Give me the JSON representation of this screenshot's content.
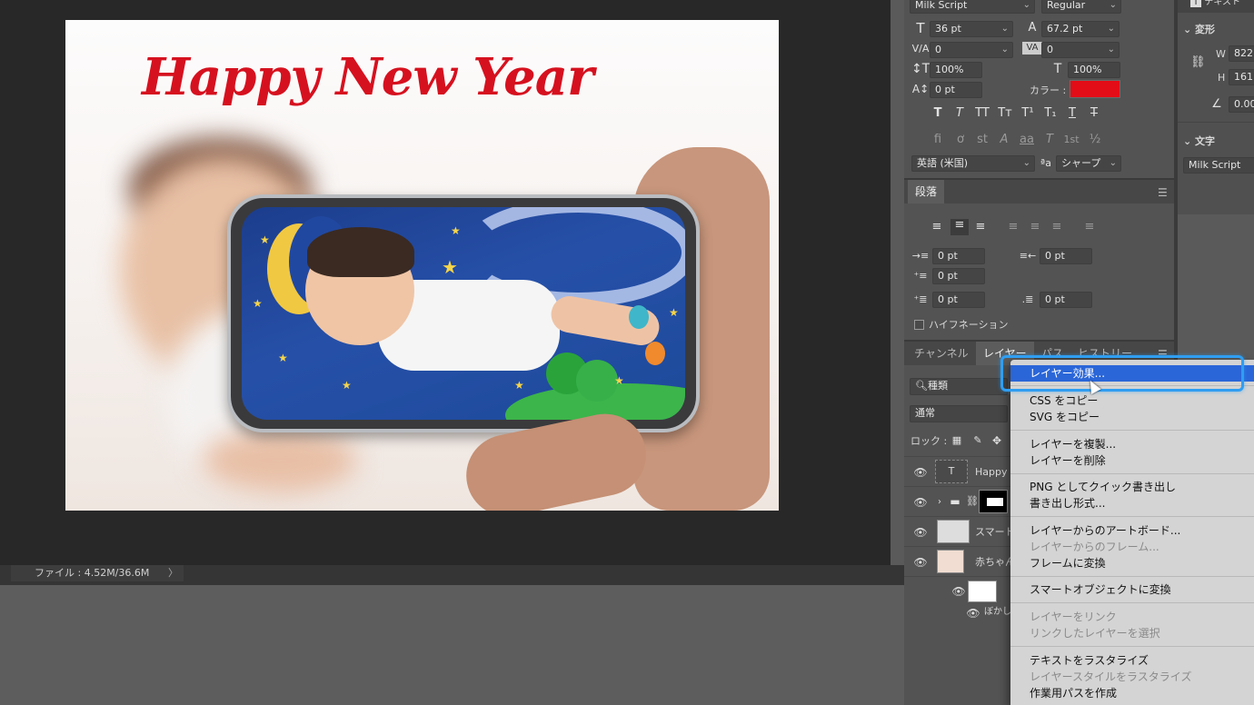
{
  "canvas": {
    "headline": "Happy New Year"
  },
  "status": {
    "file_info": "ファイル : 4.52M/36.6M",
    "arrow": "〉"
  },
  "character": {
    "font_family": "Milk Script",
    "font_style": "Regular",
    "font_size": "36 pt",
    "leading": "67.2 pt",
    "kerning": "0",
    "tracking": "0",
    "vertical_scale": "100%",
    "horizontal_scale": "100%",
    "baseline_shift": "0 pt",
    "color_label": "カラー :",
    "color": "#e30d17",
    "language": "英語 (米国)",
    "aa_icon": "a",
    "aa_label": "aa",
    "antialias": "シャープ",
    "style_buttons": [
      "T",
      "T",
      "TT",
      "Tт",
      "T¹",
      "T₁",
      "T",
      "T"
    ],
    "opentype_buttons": [
      "fi",
      "ơ",
      "st",
      "A",
      "aa",
      "T",
      "1st",
      "½"
    ]
  },
  "properties": {
    "title_top": "テキスト",
    "transform_label": "変形",
    "w_label": "W",
    "w_value": "822.",
    "h_label": "H",
    "h_value": "161.",
    "angle_value": "0.00",
    "text_label": "文字",
    "font_value": "Milk Script"
  },
  "paragraph": {
    "tab": "段落",
    "indent_left": "0 pt",
    "indent_right": "0 pt",
    "first_line": "0 pt",
    "space_before": "0 pt",
    "space_after": "0 pt",
    "hyphenation": "ハイフネーション"
  },
  "layers": {
    "tabs": [
      "チャンネル",
      "レイヤー",
      "パス",
      "ヒストリー"
    ],
    "search_kind": "種類",
    "blend_mode": "通常",
    "lock_label": "ロック :",
    "rows": [
      {
        "name": "Happy"
      },
      {
        "name": ""
      },
      {
        "name": "スマート"
      },
      {
        "name": "赤ちゃん"
      }
    ],
    "blur_label": "ぼかし"
  },
  "context_menu": {
    "items": [
      {
        "label": "レイヤー効果...",
        "state": "highlighted"
      },
      {
        "label": "CSS をコピー",
        "state": "enabled"
      },
      {
        "label": "SVG をコピー",
        "state": "enabled"
      },
      {
        "label": "レイヤーを複製...",
        "state": "enabled"
      },
      {
        "label": "レイヤーを削除",
        "state": "enabled"
      },
      {
        "label": "PNG としてクイック書き出し",
        "state": "enabled"
      },
      {
        "label": "書き出し形式...",
        "state": "enabled"
      },
      {
        "label": "レイヤーからのアートボード...",
        "state": "enabled"
      },
      {
        "label": "レイヤーからのフレーム...",
        "state": "disabled"
      },
      {
        "label": "フレームに変換",
        "state": "enabled"
      },
      {
        "label": "スマートオブジェクトに変換",
        "state": "enabled"
      },
      {
        "label": "レイヤーをリンク",
        "state": "disabled"
      },
      {
        "label": "リンクしたレイヤーを選択",
        "state": "disabled"
      },
      {
        "label": "テキストをラスタライズ",
        "state": "enabled"
      },
      {
        "label": "レイヤースタイルをラスタライズ",
        "state": "disabled"
      },
      {
        "label": "作業用パスを作成",
        "state": "enabled"
      }
    ]
  }
}
